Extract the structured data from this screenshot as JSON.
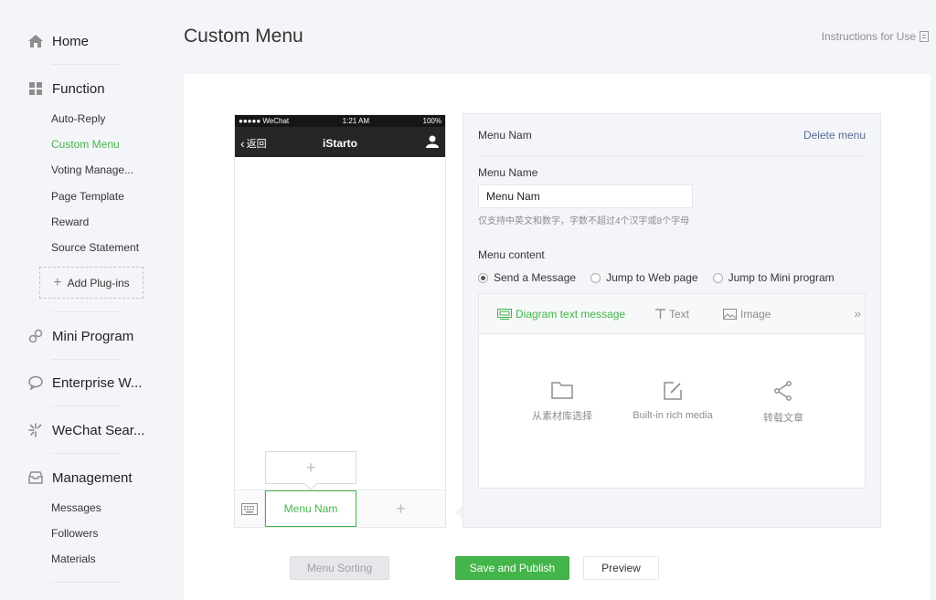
{
  "sidebar": {
    "home": "Home",
    "function": "Function",
    "function_items": [
      "Auto-Reply",
      "Custom Menu",
      "Voting Manage...",
      "Page Template",
      "Reward",
      "Source Statement"
    ],
    "add_plugins": "Add Plug-ins",
    "mini_program": "Mini Program",
    "enterprise": "Enterprise W...",
    "wechat_search": "WeChat Sear...",
    "management": "Management",
    "management_items": [
      "Messages",
      "Followers",
      "Materials"
    ]
  },
  "header": {
    "title": "Custom Menu",
    "instructions": "Instructions for Use"
  },
  "phone": {
    "status_carrier": "●●●●● WeChat",
    "status_time": "1:21 AM",
    "status_battery": "100%",
    "back": "返回",
    "title": "iStarto",
    "menu_tab": "Menu Nam"
  },
  "editor": {
    "menu_name": "Menu Nam",
    "delete": "Delete menu",
    "name_label": "Menu Name",
    "name_value": "Menu Nam",
    "name_hint": "仅支持中英文和数字，字数不超过4个汉字或8个字母",
    "content_label": "Menu content",
    "radios": [
      "Send a Message",
      "Jump to Web page",
      "Jump to Mini program"
    ],
    "tabs": [
      "Diagram text message",
      "Text",
      "Image"
    ],
    "options": [
      "从素材库选择",
      "Built-in rich media",
      "转载文章"
    ]
  },
  "buttons": {
    "sort": "Menu Sorting",
    "save": "Save and Publish",
    "preview": "Preview"
  },
  "colors": {
    "accent": "#44b549",
    "link": "#576b95",
    "phone_nav": "#262626"
  }
}
